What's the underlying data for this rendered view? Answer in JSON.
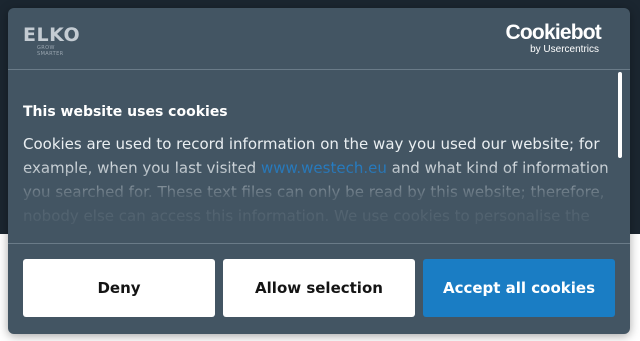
{
  "brand": {
    "site_logo_text": "ELKO",
    "site_logo_tagline": "GROW SMARTER",
    "cmp_logo_text": "Cookiebot",
    "cmp_logo_subtext": "by Usercentrics"
  },
  "banner": {
    "title": "This website uses cookies",
    "text_before_link": "Cookies are used to record information on the way you used our website; for example, when you last visited ",
    "link_text": "www.westech.eu",
    "text_after_link": " and what kind of information you searched for. These text files can only be read by this website; therefore, nobody else can access this information. We use cookies to personalise the"
  },
  "buttons": {
    "deny": "Deny",
    "allow_selection": "Allow selection",
    "accept_all": "Accept all cookies"
  },
  "colors": {
    "dialog_bg": "#435563",
    "accent": "#1a7dc4",
    "link": "#1f84d6",
    "backdrop": "#1b2630"
  }
}
